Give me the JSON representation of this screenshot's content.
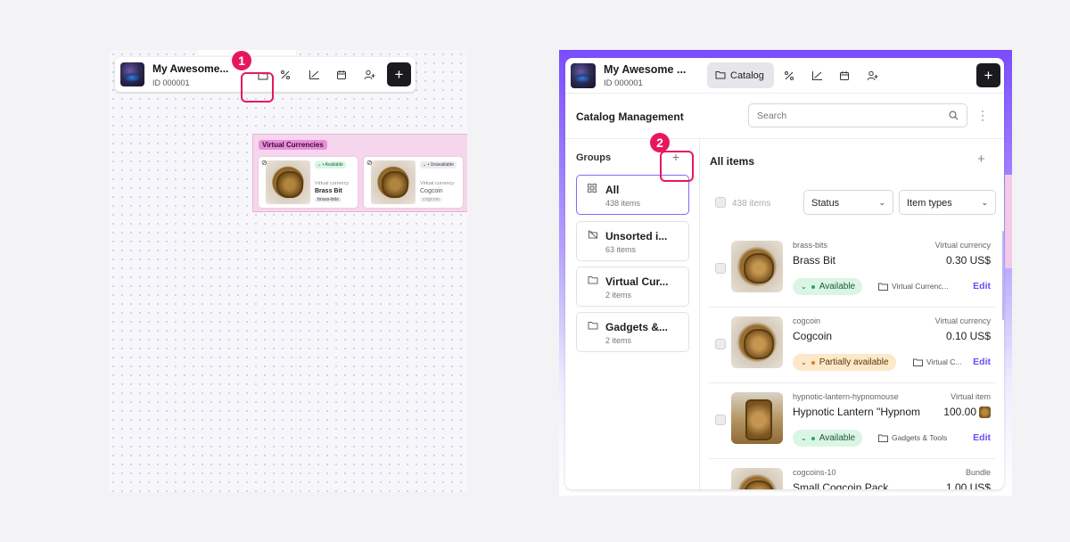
{
  "left": {
    "project": {
      "title": "My Awesome...",
      "id": "ID 000001"
    },
    "step_badge": "1",
    "toolbar_icons": [
      "folder-icon",
      "percent-icon",
      "chart-icon",
      "calendar-icon",
      "user-add-icon"
    ],
    "plus_label": "+",
    "group": {
      "label": "Virtual Currencies",
      "cards": [
        {
          "status": "Available",
          "kind": "Virtual currency",
          "name": "Brass Bit",
          "slug": "brass-bits"
        },
        {
          "status": "Unavailable",
          "kind": "Virtual currency",
          "name": "Cogcoin",
          "slug": "cogcoin"
        }
      ]
    }
  },
  "right": {
    "project": {
      "title": "My Awesome ...",
      "id": "ID 000001"
    },
    "catalog_tab": "Catalog",
    "plus_label": "+",
    "management_title": "Catalog Management",
    "search_placeholder": "Search",
    "groups": {
      "title": "Groups",
      "step_badge": "2",
      "add_label": "+",
      "items": [
        {
          "name": "All",
          "count": "438 items",
          "icon": "grid-icon",
          "selected": true
        },
        {
          "name": "Unsorted i...",
          "count": "63 items",
          "icon": "hidden-icon"
        },
        {
          "name": "Virtual Cur...",
          "count": "2 items",
          "icon": "folder-icon"
        },
        {
          "name": "Gadgets &...",
          "count": "2 items",
          "icon": "folder-icon"
        }
      ]
    },
    "items": {
      "title": "All items",
      "add_label": "+",
      "count": "438 items",
      "status_filter": "Status",
      "type_filter": "Item types",
      "rows": [
        {
          "slug": "brass-bits",
          "type": "Virtual currency",
          "name": "Brass Bit",
          "price": "0.30 US$",
          "status": "Available",
          "status_color": "green",
          "folder": "Virtual Currenc...",
          "edit": "Edit"
        },
        {
          "slug": "cogcoin",
          "type": "Virtual currency",
          "name": "Cogcoin",
          "price": "0.10 US$",
          "status": "Partially available",
          "status_color": "orange",
          "folder": "Virtual C...",
          "edit": "Edit"
        },
        {
          "slug": "hypnotic-lantern-hypnomouse",
          "type": "Virtual item",
          "name": "Hypnotic Lantern \"Hypnom",
          "price": "100.00",
          "status": "Available",
          "status_color": "green",
          "folder": "Gadgets & Tools",
          "edit": "Edit"
        },
        {
          "slug": "cogcoins-10",
          "type": "Bundle",
          "name": "Small Cogcoin Pack",
          "price": "1.00 US$"
        }
      ]
    }
  }
}
